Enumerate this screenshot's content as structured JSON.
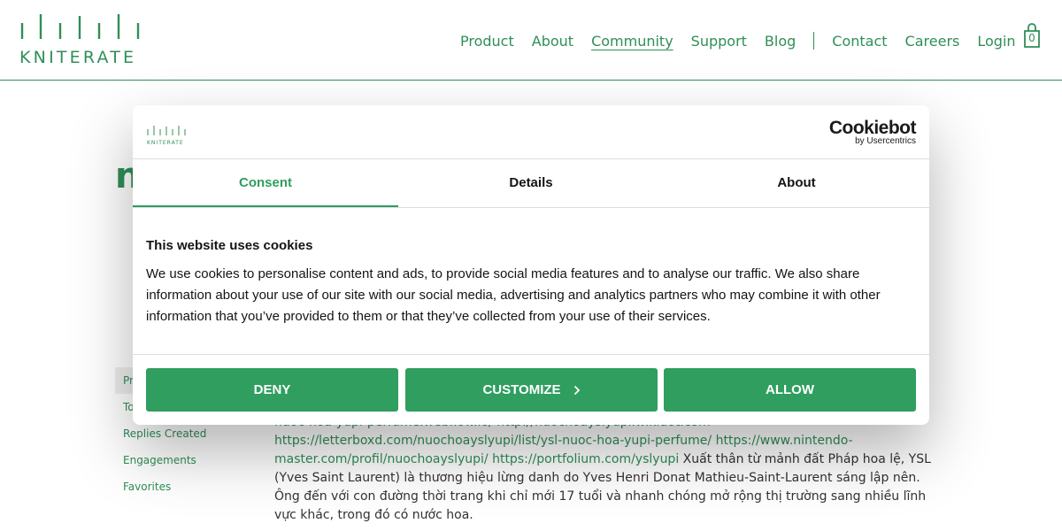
{
  "header": {
    "logo_text": "KNITERATE",
    "nav": [
      {
        "label": "Product"
      },
      {
        "label": "About"
      },
      {
        "label": "Community",
        "active": true
      },
      {
        "label": "Support"
      },
      {
        "label": "Blog"
      },
      {
        "label": "Contact"
      },
      {
        "label": "Careers"
      },
      {
        "label": "Login"
      }
    ],
    "cart_count": "0",
    "cart_icon": "shopping-bag-icon"
  },
  "page": {
    "title_fragment": "n",
    "side_menu": [
      {
        "label": "Pr"
      },
      {
        "label": "To"
      },
      {
        "label": "Replies Created"
      },
      {
        "label": "Engagements"
      },
      {
        "label": "Favorites"
      }
    ],
    "content": {
      "link_1": "nuoc-hoa-yupi-perfume.webflow.io/",
      "link_2": "http://nuochoayslyupi.wikidot.com",
      "link_3": "https://letterboxd.com/nuochoayslyupi/list/ysl-nuoc-hoa-yupi-perfume/",
      "link_4": "https://www.nintendo-master.com/profil/nuochoayslyupi/",
      "link_5": "https://portfolium.com/yslyupi",
      "text": "Xuất thân từ mảnh đất Pháp hoa lệ, YSL (Yves Saint Laurent) là thương hiệu lừng danh do Yves Henri Donat Mathieu-Saint-Laurent sáng lập nên. Ông đến với con đường thời trang khi chỉ mới 17 tuổi và nhanh chóng mở rộng thị trường sang nhiều lĩnh vực khác, trong đó có nước hoa."
    }
  },
  "cookie_dialog": {
    "logo_text": "KNITERATE",
    "brand_name": "Cookiebot",
    "brand_sub": "by Usercentrics",
    "tabs": [
      {
        "label": "Consent",
        "active": true
      },
      {
        "label": "Details"
      },
      {
        "label": "About"
      }
    ],
    "heading": "This website uses cookies",
    "body": "We use cookies to personalise content and ads, to provide social media features and to analyse our traffic. We also share information about your use of our site with our social media, advertising and analytics partners who may combine it with other information that you’ve provided to them or that they’ve collected from your use of their services.",
    "buttons": {
      "deny": "DENY",
      "customize": "CUSTOMIZE",
      "allow": "ALLOW"
    }
  },
  "colors": {
    "brand_green": "#2f8f57",
    "button_green": "#2f9e5f"
  }
}
